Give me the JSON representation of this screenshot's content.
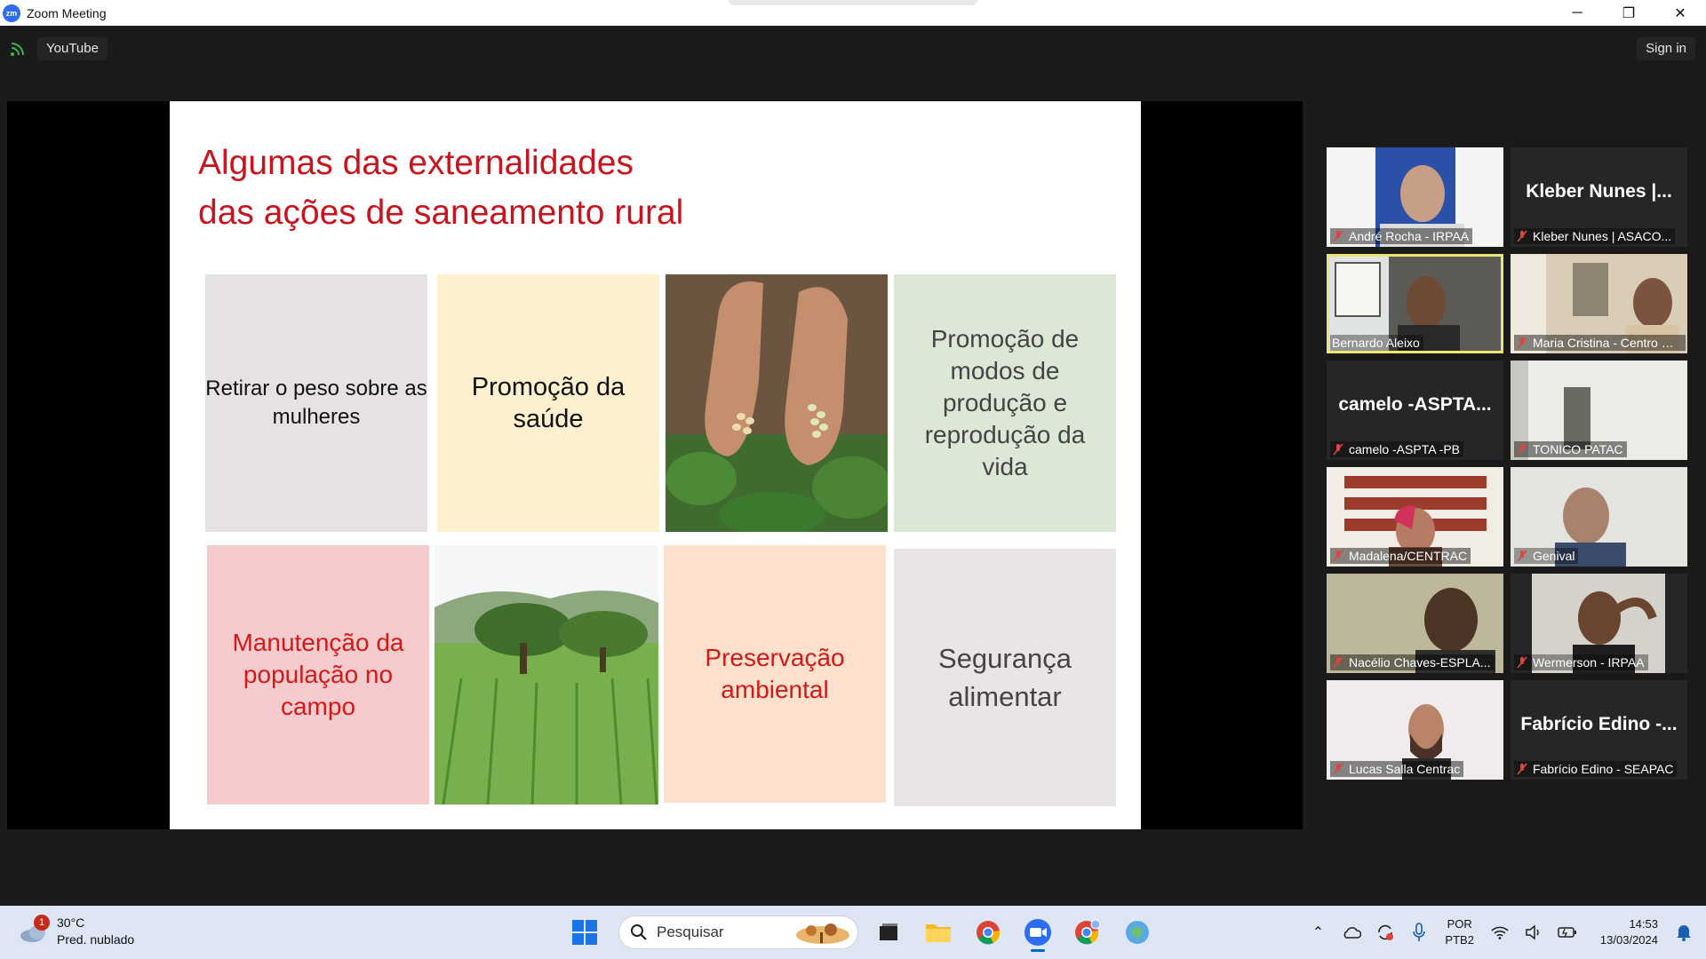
{
  "window": {
    "title": "Zoom Meeting",
    "app_icon_text": "zm",
    "minimize_icon": "─",
    "restore_icon": "❐",
    "close_icon": "✕"
  },
  "toolbar": {
    "stream_label": "YouTube",
    "signin_label": "Sign in"
  },
  "slide": {
    "title": "Algumas das externalidades das ações de saneamento rural",
    "tiles": [
      "Retirar o peso sobre as mulheres",
      "Promoção da saúde",
      "Promoção de modos de produção e reprodução da vida",
      "Manutenção da população no campo",
      "Preservação ambiental",
      "Segurança alimentar"
    ]
  },
  "participants": [
    {
      "name": "André Rocha - IRPAA",
      "big_name": ""
    },
    {
      "name": "Kleber Nunes | ASACO...",
      "big_name": "Kleber Nunes |..."
    },
    {
      "name": "Bernardo Aleixo",
      "big_name": ""
    },
    {
      "name": "Maria Cristina - Centro Sa...",
      "big_name": ""
    },
    {
      "name": "camelo -ASPTA -PB",
      "big_name": "camelo -ASPTA..."
    },
    {
      "name": "TONICO PATAC",
      "big_name": ""
    },
    {
      "name": "Madalena/CENTRAC",
      "big_name": ""
    },
    {
      "name": "Genival",
      "big_name": ""
    },
    {
      "name": "Nacélio Chaves-ESPLA...",
      "big_name": ""
    },
    {
      "name": "Wermerson - IRPAA",
      "big_name": ""
    },
    {
      "name": "Lucas Salla Centrac",
      "big_name": ""
    },
    {
      "name": "Fabrício Edino - SEAPAC",
      "big_name": "Fabrício Edino -..."
    }
  ],
  "taskbar": {
    "weather_temp": "30°C",
    "weather_desc": "Pred. nublado",
    "weather_badge": "1",
    "search_placeholder": "Pesquisar",
    "lang_top": "POR",
    "lang_bottom": "PTB2",
    "time": "14:53",
    "date": "13/03/2024"
  },
  "colors": {
    "slide_title": "#c8141e",
    "active_speaker_border": "#e9e672",
    "muted_mic": "#e0443e"
  }
}
